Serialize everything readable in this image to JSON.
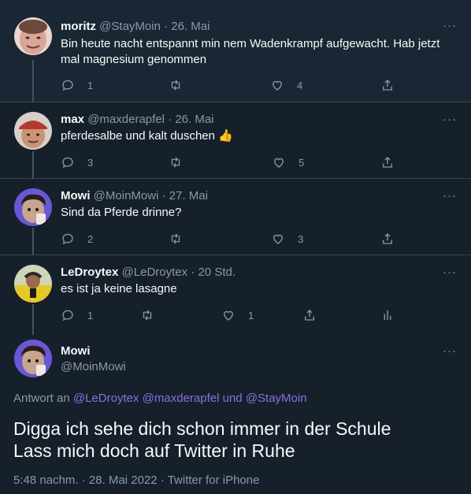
{
  "replies": [
    {
      "name": "moritz",
      "handle": "@StayMoin",
      "date": "26. Mai",
      "text": "Bin heute nacht entspannt min nem Wadenkrampf aufgewacht. Hab jetzt mal magnesium genommen",
      "replies": "1",
      "retweets": "",
      "likes": "4",
      "avatar_icon": "avatar-moritz"
    },
    {
      "name": "max",
      "handle": "@maxderapfel",
      "date": "26. Mai",
      "text": "pferdesalbe und kalt duschen 👍",
      "replies": "3",
      "retweets": "",
      "likes": "5",
      "avatar_icon": "avatar-max"
    },
    {
      "name": "Mowi",
      "handle": "@MoinMowi",
      "date": "27. Mai",
      "text": "Sind da Pferde drinne?",
      "replies": "2",
      "retweets": "",
      "likes": "3",
      "avatar_icon": "avatar-mowi"
    },
    {
      "name": "LeDroytex",
      "handle": "@LeDroytex",
      "date": "20 Std.",
      "text": "es ist ja keine lasagne",
      "replies": "1",
      "retweets": "",
      "likes": "1",
      "avatar_icon": "avatar-ledroytex"
    }
  ],
  "main": {
    "name": "Mowi",
    "handle": "@MoinMowi",
    "replying_prefix": "Antwort an",
    "mention1": "@LeDroytex",
    "mention2": "@maxderapfel",
    "and": "und",
    "mention3": "@StayMoin",
    "line1": "Digga ich sehe dich schon immer in der Schule",
    "line2": "Lass mich doch auf Twitter in Ruhe",
    "time": "5:48 nachm.",
    "sep": "·",
    "date": "28. Mai 2022",
    "client": "Twitter for iPhone"
  },
  "more_label": "···",
  "dot": "·",
  "colors": {
    "background": "#15202b",
    "highlight": "#192734",
    "border": "#38444d",
    "secondary_text": "#8b98a5",
    "mention": "#8a6fe3"
  }
}
